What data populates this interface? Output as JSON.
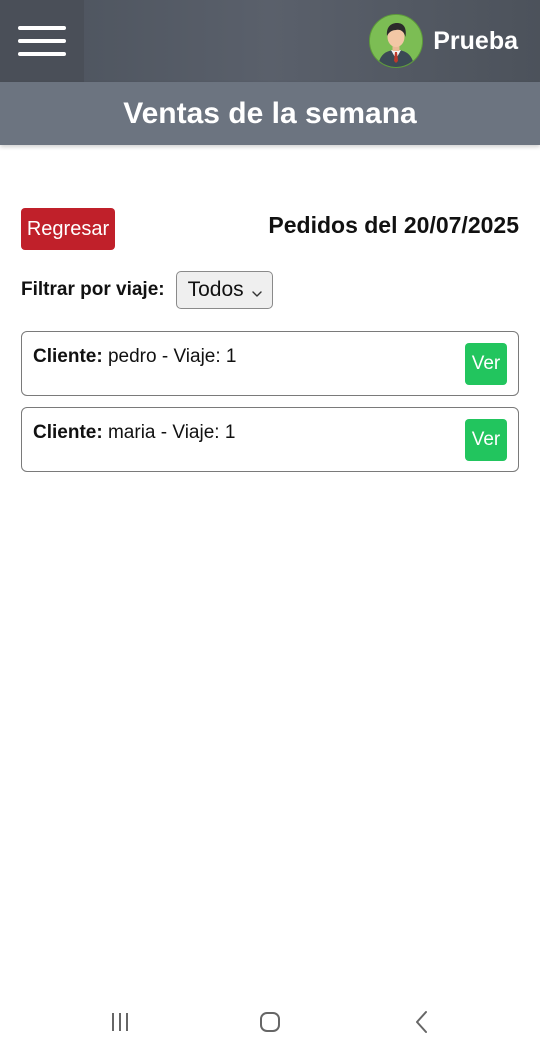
{
  "header": {
    "menu_icon": "hamburger-menu-icon",
    "user_name": "Prueba",
    "avatar_icon": "user-avatar-icon",
    "bg_color": "#4f555f"
  },
  "subheader": {
    "title": "Ventas de la semana",
    "bg_color": "#6c7480"
  },
  "toolbar": {
    "back_label": "Regresar",
    "back_color": "#c0202a",
    "orders_title": "Pedidos del 20/07/2025"
  },
  "filter": {
    "label": "Filtrar por viaje:",
    "selected": "Todos",
    "icon": "chevron-down-icon"
  },
  "orders": [
    {
      "client_label": "Cliente:",
      "client": "pedro",
      "trip_text": " - Viaje: 1",
      "view_label": "Ver"
    },
    {
      "client_label": "Cliente:",
      "client": "maria",
      "trip_text": " - Viaje: 1",
      "view_label": "Ver"
    }
  ],
  "view_color": "#22c55e",
  "system_nav": {
    "recents_icon": "recent-apps-icon",
    "home_icon": "home-icon",
    "back_icon": "back-icon"
  }
}
